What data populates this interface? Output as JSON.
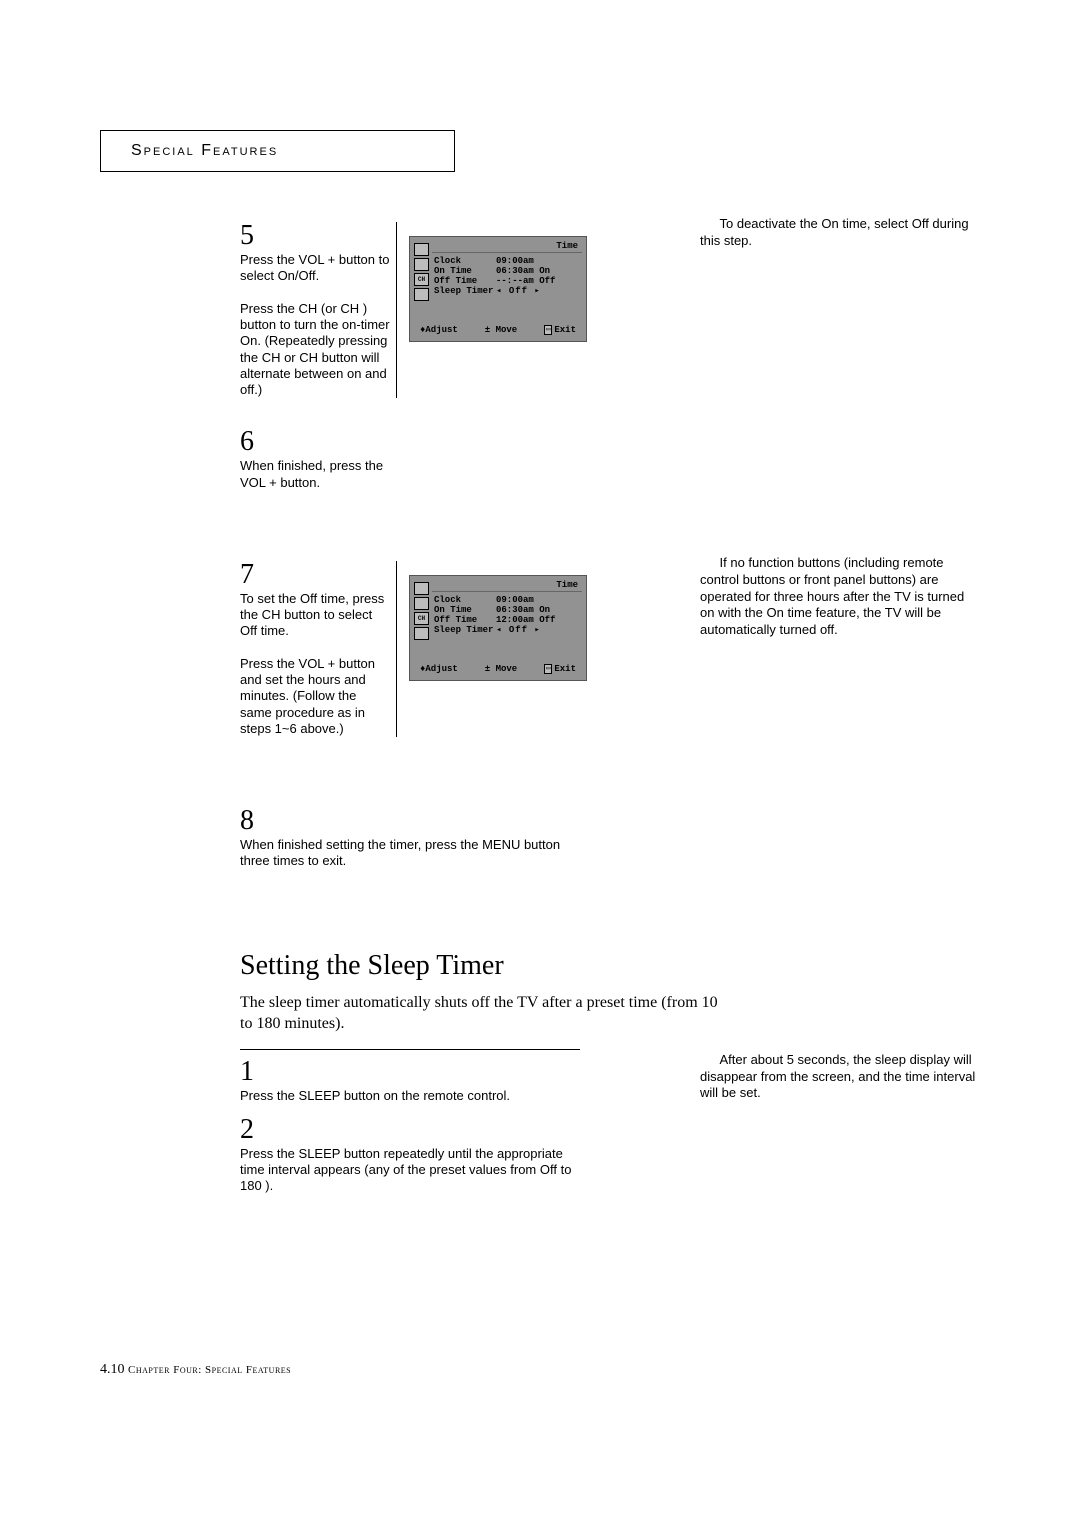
{
  "header": {
    "title": "Special Features"
  },
  "steps": {
    "s5": {
      "num": "5",
      "p1a": "Press the ",
      "p1b": "VOL +",
      "p1c": " button to select  On/Off.",
      "p2a": "Press the ",
      "p2b": "CH ",
      "p2c": " (or ",
      "p2d": "CH ",
      "p2e": ") button  to turn the on-timer On. (Repeatedly pressing the ",
      "p2f": "CH ",
      "p2g": " or CH  button will alternate between on and off.)"
    },
    "s6": {
      "num": "6",
      "p1a": "When finished, press the VOL + button."
    },
    "s7": {
      "num": "7",
      "p1": "To set the Off time, press the CH  button to select Off time.",
      "p2": "Press the VOL + button and set the hours and minutes. (Follow the same procedure as in steps 1~6 above.)"
    },
    "s8": {
      "num": "8",
      "p1": "When finished setting the timer, press the MENU button three times to exit."
    },
    "st1": {
      "num": "1",
      "p1": "Press the SLEEP button on the remote control."
    },
    "st2": {
      "num": "2",
      "p1": "Press the SLEEP button  repeatedly until the appropriate time interval appears (any of the preset values from  Off  to  180 )."
    }
  },
  "notes": {
    "n1": "To deactivate the  On time, select  Off  during this step.",
    "n2": "If no function buttons (including remote control buttons or front panel buttons) are operated for three hours after the TV is turned on with the  On time  feature, the TV will be automatically turned off.",
    "n3": "After about 5 seconds, the sleep display will disappear from the screen, and the time interval will be set."
  },
  "osd1": {
    "title": "Time",
    "lines": [
      {
        "label": "Clock",
        "value": "09:00am"
      },
      {
        "label": "On Time",
        "value": "06:30am On"
      },
      {
        "label": "Off Time",
        "value": "--:--am Off"
      },
      {
        "label": "Sleep Timer",
        "value": "◂ Off ▸"
      }
    ],
    "footer": {
      "adjust": "♦Adjust",
      "move": "± Move",
      "exit": "Exit",
      "exit_box": "▭"
    }
  },
  "osd2": {
    "title": "Time",
    "lines": [
      {
        "label": "Clock",
        "value": "09:00am"
      },
      {
        "label": "On Time",
        "value": "06:30am On"
      },
      {
        "label": "Off Time",
        "value": "12:00am Off"
      },
      {
        "label": "Sleep Timer",
        "value": "◂ Off ▸"
      }
    ],
    "footer": {
      "adjust": "♦Adjust",
      "move": "± Move",
      "exit": "Exit",
      "exit_box": "▭"
    }
  },
  "section": {
    "title": "Setting the Sleep Timer",
    "lead": "The sleep timer automatically shuts off the TV after a preset time (from 10 to 180 minutes)."
  },
  "footer": {
    "page": "4.10",
    "chapter": " Chapter Four: Special Features"
  }
}
